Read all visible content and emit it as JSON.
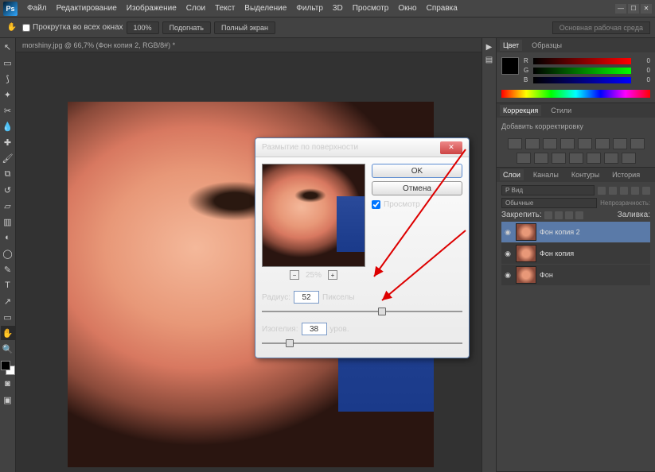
{
  "app_logo": "Ps",
  "menu": [
    "Файл",
    "Редактирование",
    "Изображение",
    "Слои",
    "Текст",
    "Выделение",
    "Фильтр",
    "3D",
    "Просмотр",
    "Окно",
    "Справка"
  ],
  "options": {
    "scroll_all": "Прокрутка во всех окнах",
    "btn100": "100%",
    "btn_fit": "Подогнать",
    "btn_full": "Полный экран",
    "workspace": "Основная рабочая среда"
  },
  "doc_tab": "morshiny.jpg @ 66,7% (Фон копия 2, RGB/8#) *",
  "color_panel": {
    "tab1": "Цвет",
    "tab2": "Образцы",
    "r": "R",
    "g": "G",
    "b": "B",
    "rv": "0",
    "gv": "0",
    "bv": "0"
  },
  "adjustments": {
    "tab1": "Коррекция",
    "tab2": "Стили",
    "add": "Добавить корректировку"
  },
  "layers_panel": {
    "tab1": "Слои",
    "tab2": "Каналы",
    "tab3": "Контуры",
    "tab4": "История",
    "kind": "Р Вид",
    "blend": "Обычные",
    "opacity_label": "Непрозрачность:",
    "lock_label": "Закрепить:",
    "fill_label": "Заливка:"
  },
  "layers": [
    {
      "name": "Фон копия 2"
    },
    {
      "name": "Фон копия"
    },
    {
      "name": "Фон"
    }
  ],
  "dialog": {
    "title": "Размытие по поверхности",
    "ok": "OK",
    "cancel": "Отмена",
    "preview": "Просмотр",
    "zoom": "25%",
    "radius_label": "Радиус:",
    "radius_val": "52",
    "radius_unit": "Пикселы",
    "threshold_label": "Изогелия:",
    "threshold_val": "38",
    "threshold_unit": "уров."
  },
  "chart_data": {
    "type": "table",
    "note": "no chart in image"
  }
}
